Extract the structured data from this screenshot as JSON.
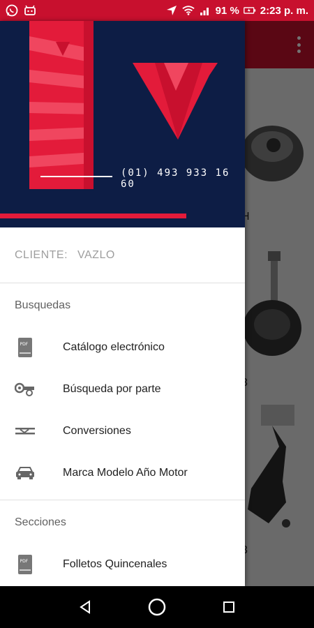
{
  "status_bar": {
    "battery": "91 %",
    "time": "2:23 p. m.",
    "icons": [
      "whatsapp-icon",
      "notification-icon",
      "location-arrow-icon",
      "wifi-icon",
      "signal-icon",
      "battery-charging-icon"
    ]
  },
  "header": {
    "phone": "(01) 493 933 16 60",
    "colors": {
      "navy": "#0d1d45",
      "red": "#e31b3a"
    }
  },
  "client": {
    "label": "CLIENTE:",
    "value": "VAZLO"
  },
  "sections": [
    {
      "title": "Busquedas",
      "items": [
        {
          "label": "Catálogo electrónico",
          "icon": "pdf-book-icon"
        },
        {
          "label": "Búsqueda por parte",
          "icon": "parts-icon"
        },
        {
          "label": "Conversiones",
          "icon": "conversion-icon"
        },
        {
          "label": "Marca Modelo Año Motor",
          "icon": "car-icon"
        }
      ]
    },
    {
      "title": "Secciones",
      "items": [
        {
          "label": "Folletos Quincenales",
          "icon": "pdf-book-icon"
        }
      ]
    }
  ],
  "background": {
    "label_1": "H",
    "label_2": "3",
    "label_3": "3"
  },
  "nav": {
    "icons": [
      "back-icon",
      "home-icon",
      "recents-icon"
    ]
  }
}
